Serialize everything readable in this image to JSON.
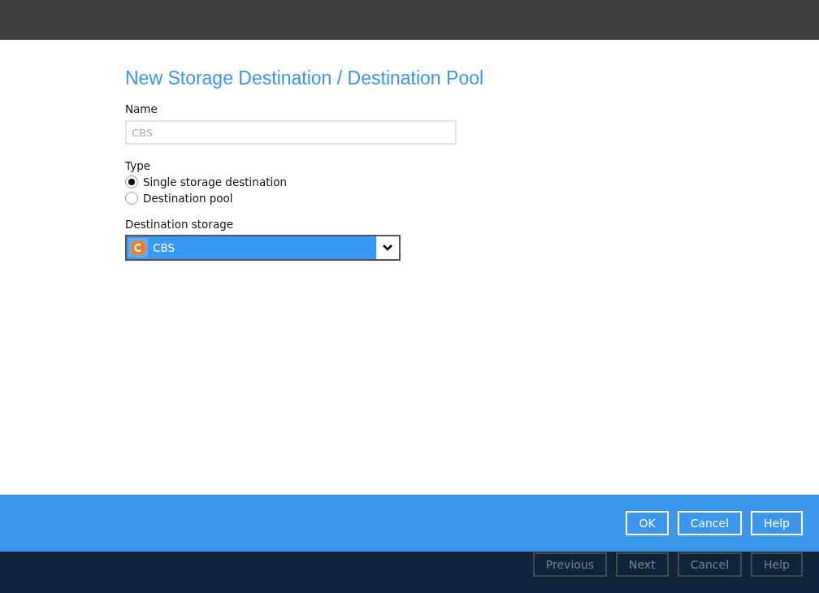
{
  "title": "New Storage Destination / Destination Pool",
  "name_field": {
    "label": "Name",
    "placeholder": "CBS"
  },
  "type": {
    "label": "Type",
    "options": [
      {
        "label": "Single storage destination",
        "selected": true
      },
      {
        "label": "Destination pool",
        "selected": false
      }
    ]
  },
  "destination_storage": {
    "label": "Destination storage",
    "value": "CBS"
  },
  "dialog_buttons": [
    "OK",
    "Cancel",
    "Help"
  ],
  "wizard_buttons": [
    {
      "label": "Previous",
      "disabled": true
    },
    {
      "label": "Next",
      "disabled": true
    },
    {
      "label": "Cancel",
      "disabled": true
    },
    {
      "label": "Help",
      "disabled": true
    }
  ]
}
